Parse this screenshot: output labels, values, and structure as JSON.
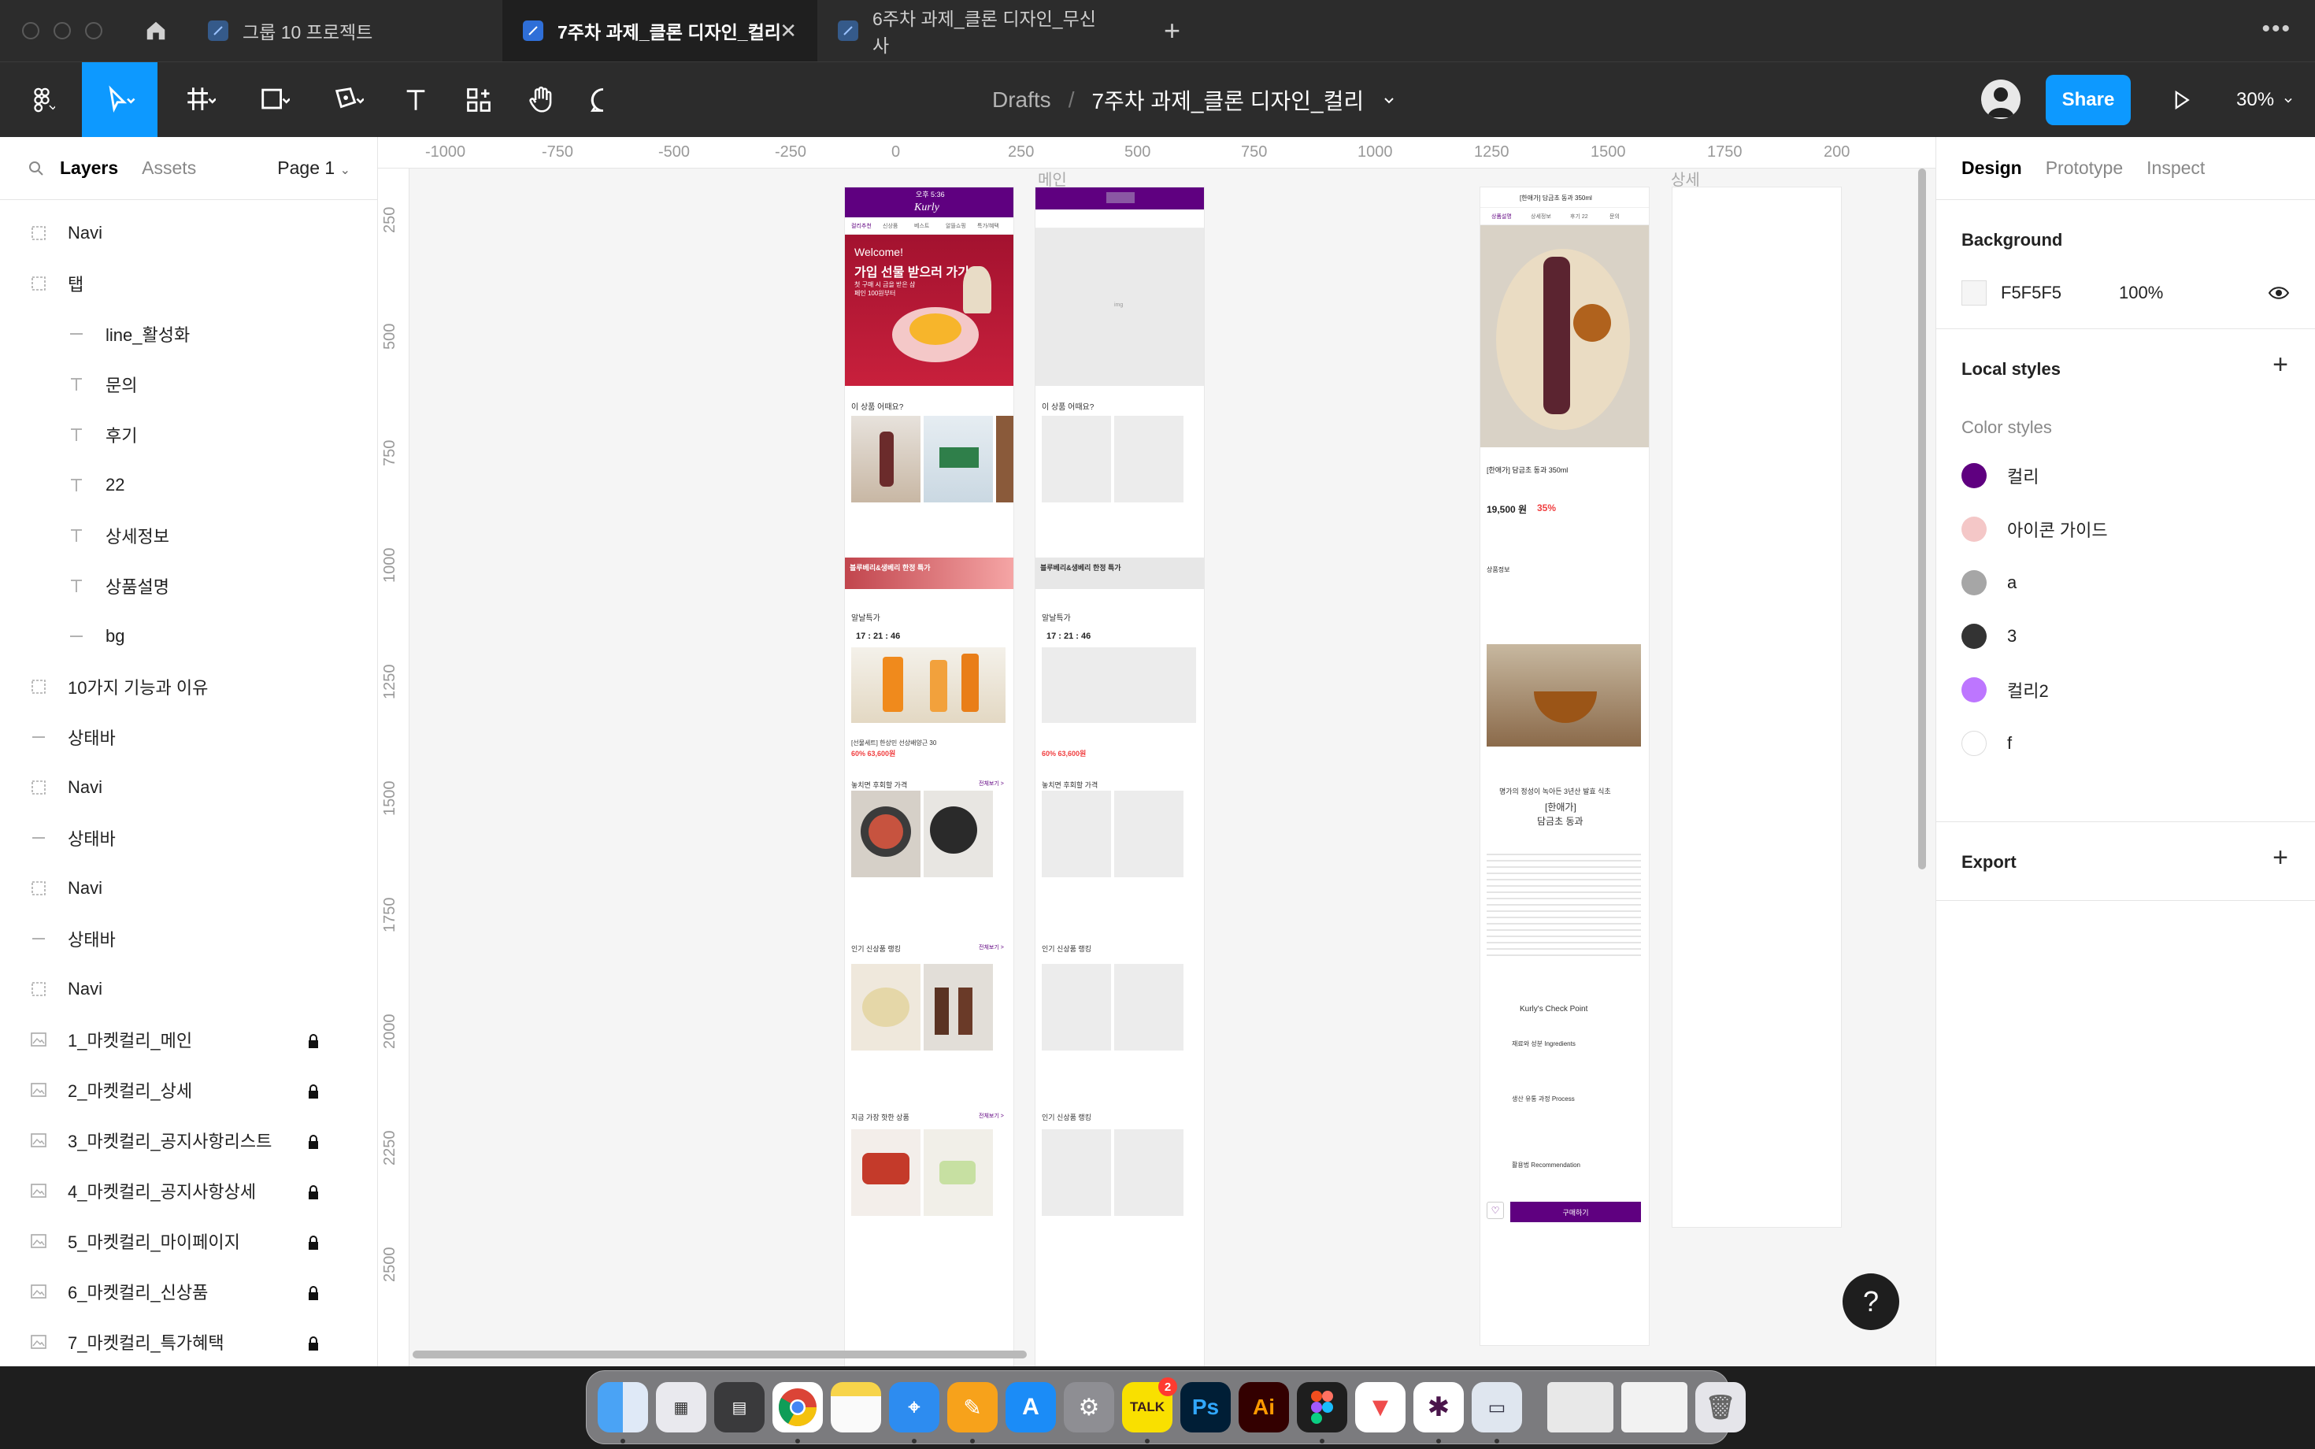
{
  "tabs": [
    {
      "label": "그룹 10 프로젝트",
      "active": false
    },
    {
      "label": "7주차 과제_클론 디자인_컬리",
      "active": true
    },
    {
      "label": "6주차 과제_클론 디자인_무신사",
      "active": false
    }
  ],
  "toolbar": {
    "breadcrumb_root": "Drafts",
    "breadcrumb_sep": "/",
    "file_name": "7주차 과제_클론 디자인_컬리",
    "share_label": "Share",
    "zoom": "30%"
  },
  "left_panel": {
    "tab_layers": "Layers",
    "tab_assets": "Assets",
    "page": "Page 1",
    "layers": [
      {
        "name": "Navi",
        "icon": "frame-icon",
        "indent": 0,
        "locked": false
      },
      {
        "name": "탭",
        "icon": "frame-icon",
        "indent": 0,
        "locked": false
      },
      {
        "name": "line_활성화",
        "icon": "line-icon",
        "indent": 1,
        "locked": false
      },
      {
        "name": "문의",
        "icon": "text-icon",
        "indent": 1,
        "locked": false
      },
      {
        "name": "후기",
        "icon": "text-icon",
        "indent": 1,
        "locked": false
      },
      {
        "name": "22",
        "icon": "text-icon",
        "indent": 1,
        "locked": false
      },
      {
        "name": "상세정보",
        "icon": "text-icon",
        "indent": 1,
        "locked": false
      },
      {
        "name": "상품설명",
        "icon": "text-icon",
        "indent": 1,
        "locked": false
      },
      {
        "name": "bg",
        "icon": "line-icon",
        "indent": 1,
        "locked": false
      },
      {
        "name": "10가지 기능과 이유",
        "icon": "frame-icon",
        "indent": 0,
        "locked": false
      },
      {
        "name": "상태바",
        "icon": "line-icon",
        "indent": 0,
        "locked": false
      },
      {
        "name": "Navi",
        "icon": "frame-icon",
        "indent": 0,
        "locked": false
      },
      {
        "name": "상태바",
        "icon": "line-icon",
        "indent": 0,
        "locked": false
      },
      {
        "name": "Navi",
        "icon": "frame-icon",
        "indent": 0,
        "locked": false
      },
      {
        "name": "상태바",
        "icon": "line-icon",
        "indent": 0,
        "locked": false
      },
      {
        "name": "Navi",
        "icon": "frame-icon",
        "indent": 0,
        "locked": false
      },
      {
        "name": "1_마켓컬리_메인",
        "icon": "image-icon",
        "indent": 0,
        "locked": true
      },
      {
        "name": "2_마켓컬리_상세",
        "icon": "image-icon",
        "indent": 0,
        "locked": true
      },
      {
        "name": "3_마켓컬리_공지사항리스트",
        "icon": "image-icon",
        "indent": 0,
        "locked": true
      },
      {
        "name": "4_마켓컬리_공지사항상세",
        "icon": "image-icon",
        "indent": 0,
        "locked": true
      },
      {
        "name": "5_마켓컬리_마이페이지",
        "icon": "image-icon",
        "indent": 0,
        "locked": true
      },
      {
        "name": "6_마켓컬리_신상품",
        "icon": "image-icon",
        "indent": 0,
        "locked": true
      },
      {
        "name": "7_마켓컬리_특가혜택",
        "icon": "image-icon",
        "indent": 0,
        "locked": true
      }
    ]
  },
  "right_panel": {
    "tab_design": "Design",
    "tab_prototype": "Prototype",
    "tab_inspect": "Inspect",
    "background_title": "Background",
    "background_hex": "F5F5F5",
    "background_opacity": "100%",
    "local_styles_title": "Local styles",
    "color_styles_title": "Color styles",
    "color_styles": [
      {
        "name": "컬리",
        "color": "#5f0080"
      },
      {
        "name": "아이콘 가이드",
        "color": "#f4c7c7"
      },
      {
        "name": "a",
        "color": "#a6a6a6"
      },
      {
        "name": "3",
        "color": "#333333"
      },
      {
        "name": "컬리2",
        "color": "#bd76ff"
      },
      {
        "name": "f",
        "color": "#ffffff"
      }
    ],
    "export_title": "Export"
  },
  "canvas": {
    "ruler_top": [
      "-1000",
      "-750",
      "-500",
      "-250",
      "0",
      "250",
      "500",
      "750",
      "1000",
      "1250",
      "1500",
      "1750",
      "200"
    ],
    "ruler_left": [
      "250",
      "500",
      "750",
      "1000",
      "1250",
      "1500",
      "1750",
      "2000",
      "2250",
      "2500"
    ],
    "frame_labels": {
      "main": "메인",
      "detail": "상세"
    },
    "main_frame": {
      "status": "오후 5:36",
      "logo": "Kurly",
      "nav_tabs": [
        "컬리추천",
        "신상품",
        "베스트",
        "알뜰쇼핑",
        "특가/혜택"
      ],
      "banner_line1": "Welcome!",
      "banner_line2": "가입 선물 받으러 가기",
      "banner_sub": "첫 구매 시 금을 받은 샴페인 100원부터",
      "section1": "이 상품 어때요?",
      "promo": "블루베리&생베리 한정 특가",
      "section2": "알날특가",
      "timer": "17 : 21 : 46",
      "deal_name": "[선물세트] 한상민 선상배양근 30",
      "deal_price": "60% 63,600원",
      "section3": "놓치면 후회할 가격",
      "section4": "인기 신상품 랭킹",
      "section5": "지금 가장 핫한 상품",
      "more": "전체보기 >",
      "placeholder": "img"
    },
    "detail_frame": {
      "title": "[한애가] 담금초 동과 350ml",
      "tabs": [
        "상품설명",
        "상세정보",
        "후기 22",
        "문의"
      ],
      "product_name": "[한애가] 담금초 동과 350ml",
      "price": "19,500 원",
      "discount": "35%",
      "info_title": "상품정보",
      "story_line1": "명가의 정성이 녹아든 3년산 발효 식초",
      "story_line2": "[한애가]",
      "story_line3": "담금초 동과",
      "check_point": "Kurly's Check Point",
      "check_items": [
        "재료와 성분 Ingredients",
        "생산 유통 과정 Process",
        "활용법 Recommendation"
      ],
      "buy": "구매하기"
    }
  },
  "help": "?"
}
